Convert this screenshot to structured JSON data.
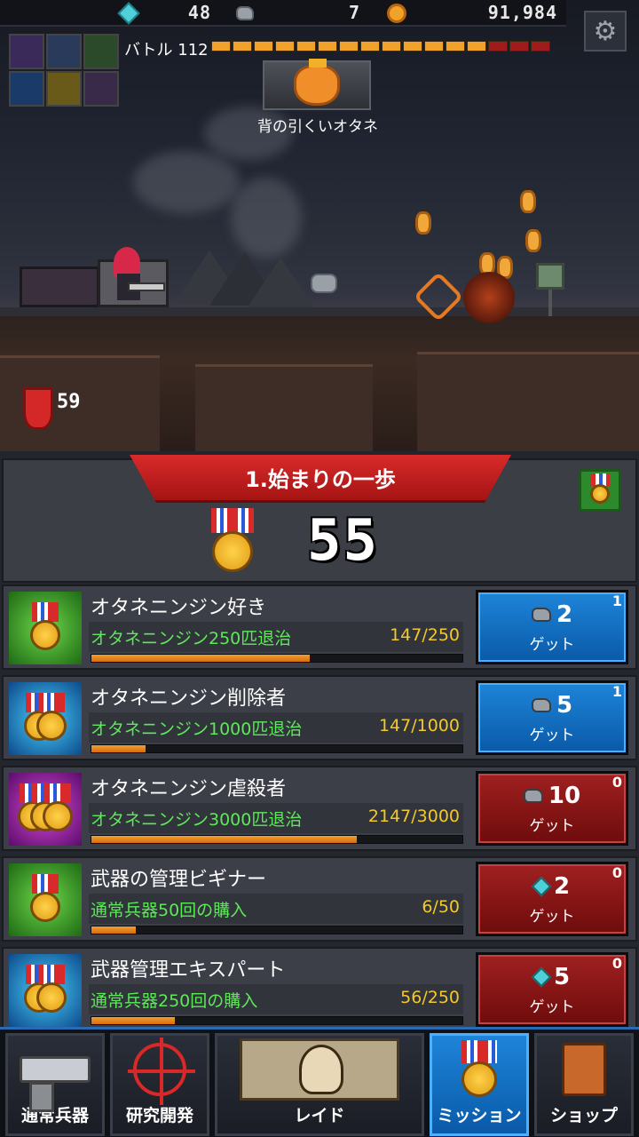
{
  "resources": {
    "gems": "48",
    "stones": "7",
    "coins": "91,984"
  },
  "battle": {
    "label": "バトル 112",
    "hp_filled": 13,
    "hp_total": 16
  },
  "boss": {
    "name": "背の引くいオタネ"
  },
  "ammo": "59",
  "mission": {
    "title": "1.始まりの一歩",
    "score": "55"
  },
  "rows": [
    {
      "title": "オタネニンジン好き",
      "desc": "オタネニンジン250匹退治",
      "progress": "147/250",
      "fraction": 0.588,
      "reward": "2",
      "reward_type": "stone",
      "get": "ゲット",
      "count": "1",
      "state": "claimable",
      "icon": "green",
      "medals": 1
    },
    {
      "title": "オタネニンジン削除者",
      "desc": "オタネニンジン1000匹退治",
      "progress": "147/1000",
      "fraction": 0.147,
      "reward": "5",
      "reward_type": "stone",
      "get": "ゲット",
      "count": "1",
      "state": "claimable",
      "icon": "blue",
      "medals": 2
    },
    {
      "title": "オタネニンジン虐殺者",
      "desc": "オタネニンジン3000匹退治",
      "progress": "2147/3000",
      "fraction": 0.716,
      "reward": "10",
      "reward_type": "stone",
      "get": "ゲット",
      "count": "0",
      "state": "locked",
      "icon": "purple",
      "medals": 3
    },
    {
      "title": "武器の管理ビギナー",
      "desc": "通常兵器50回の購入",
      "progress": "6/50",
      "fraction": 0.12,
      "reward": "2",
      "reward_type": "gem",
      "get": "ゲット",
      "count": "0",
      "state": "locked",
      "icon": "green",
      "medals": 1
    },
    {
      "title": "武器管理エキスパート",
      "desc": "通常兵器250回の購入",
      "progress": "56/250",
      "fraction": 0.224,
      "reward": "5",
      "reward_type": "gem",
      "get": "ゲット",
      "count": "0",
      "state": "locked",
      "icon": "blue",
      "medals": 2
    }
  ],
  "nav": [
    {
      "label": "通常兵器",
      "icon": "pistol-icon",
      "active": false
    },
    {
      "label": "研究開発",
      "icon": "crosshair-icon",
      "active": false
    },
    {
      "label": "レイド",
      "icon": "skull-map-icon",
      "active": false
    },
    {
      "label": "ミッション",
      "icon": "medal-icon",
      "active": true
    },
    {
      "label": "ショップ",
      "icon": "shop-bag-icon",
      "active": false
    }
  ],
  "colors": {
    "accent_red": "#d82a2a",
    "claim_blue": "#1e84d8",
    "progress_green": "#5ee85a",
    "progress_yellow": "#f3c92a"
  }
}
